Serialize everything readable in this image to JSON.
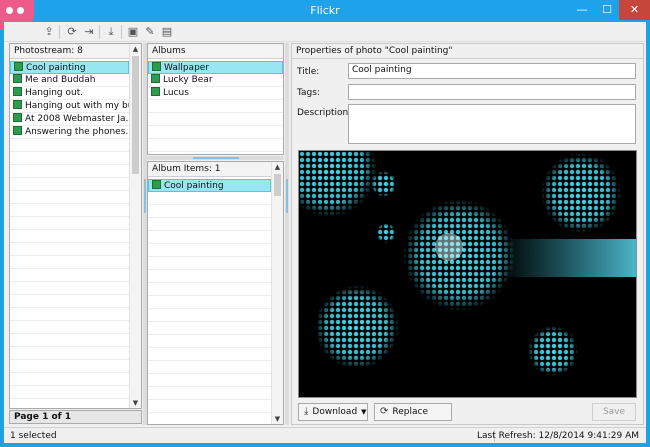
{
  "window": {
    "title": "Flickr",
    "minimize": "—",
    "maximize": "☐",
    "close": "✕"
  },
  "colors": {
    "selection": "#99e6f3",
    "selection_border": "#51c8de",
    "titlebar": "#1ea2ea",
    "logo": "#ee5a8a"
  },
  "toolbar": [
    {
      "name": "upload-icon",
      "glyph": "⇪"
    },
    {
      "name": "refresh-icon",
      "glyph": "⟳"
    },
    {
      "name": "export-icon",
      "glyph": "⇥"
    },
    {
      "name": "download-icon",
      "glyph": "⤓"
    },
    {
      "name": "photo-icon",
      "glyph": "▣"
    },
    {
      "name": "edit-icon",
      "glyph": "✎"
    },
    {
      "name": "delete-icon",
      "glyph": "▤"
    }
  ],
  "photostream": {
    "header": "Photostream: 8",
    "items": [
      "Cool painting",
      "Me and Buddah",
      "Hanging out.",
      "Hanging out with my bu...",
      "At 2008 Webmaster Ja...",
      "Answering the phones."
    ],
    "pager": "Page 1 of 1"
  },
  "albums": {
    "header": "Albums",
    "items": [
      "Wallpaper",
      "Lucky Bear",
      "Lucus"
    ]
  },
  "album_items": {
    "header": "Album Items: 1",
    "items": [
      "Cool painting"
    ]
  },
  "properties": {
    "header": "Properties of photo \"Cool painting\"",
    "title_label": "Title:",
    "title_value": "Cool painting",
    "tags_label": "Tags:",
    "tags_value": "",
    "description_label": "Description:",
    "description_value": ""
  },
  "buttons": {
    "download": "Download",
    "replace": "Replace",
    "save": "Save"
  },
  "status": {
    "selected": "1 selected",
    "last_refresh": "Last Refresh: 12/8/2014 9:41:29 AM"
  }
}
